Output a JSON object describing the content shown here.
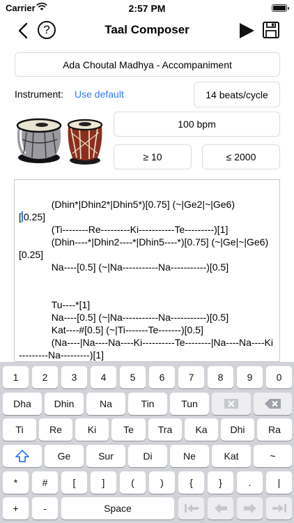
{
  "status": {
    "carrier": "Carrier",
    "time": "2:57 PM"
  },
  "nav": {
    "title": "Taal Composer",
    "help": "?"
  },
  "composition": {
    "name": "Ada Choutal Madhya - Accompaniment"
  },
  "instrument": {
    "label": "Instrument:",
    "value": "Use default"
  },
  "beats": "14 beats/cycle",
  "tempo": {
    "bpm": "100 bpm",
    "min": "≥ 10",
    "max": "≤ 2000"
  },
  "editor": {
    "first_line": "            (Dhin*|Dhin2*|Dhin5*)[0.75] (~|Ge2|~|Ge6)\n",
    "after_cursor": "0.25]\n            (Ti--------Re---------Ki-----------Te---------)[1]\n            (Dhin----*|Dhin2----*|Dhin5----*)[0.75] (~|Ge|~|Ge6)[0.25]\n            Na----[0.5] (~|Na-----------Na-----------)[0.5]\n\n\n            Tu----*[1]\n            Na----[0.5] (~|Na-----------Na-----------)[0.5]\n            Kat----#[0.5] (~|Ti-------Te-------)[0.5]\n            (Na----|Na----Na----Ki----------Te--------|Na----Na----Ki---------Na---------)[1]",
    "before_cursor": "["
  },
  "keyboard": {
    "row1": [
      "1",
      "2",
      "3",
      "4",
      "5",
      "6",
      "7",
      "8",
      "9",
      "0"
    ],
    "row2": [
      "Dha",
      "Dhin",
      "Na",
      "Tin",
      "Tun"
    ],
    "row3": [
      "Ti",
      "Re",
      "Ki",
      "Te",
      "Tra",
      "Ka",
      "Dhi",
      "Ra"
    ],
    "row4": [
      "Ge",
      "Sur",
      "Di",
      "Ne",
      "Kat",
      "~"
    ],
    "row5": [
      "*",
      "#",
      "[",
      "]",
      "(",
      ")",
      "{",
      "}",
      ".",
      "|"
    ],
    "row6": {
      "plus": "+",
      "minus": "-",
      "space": "Space"
    }
  }
}
